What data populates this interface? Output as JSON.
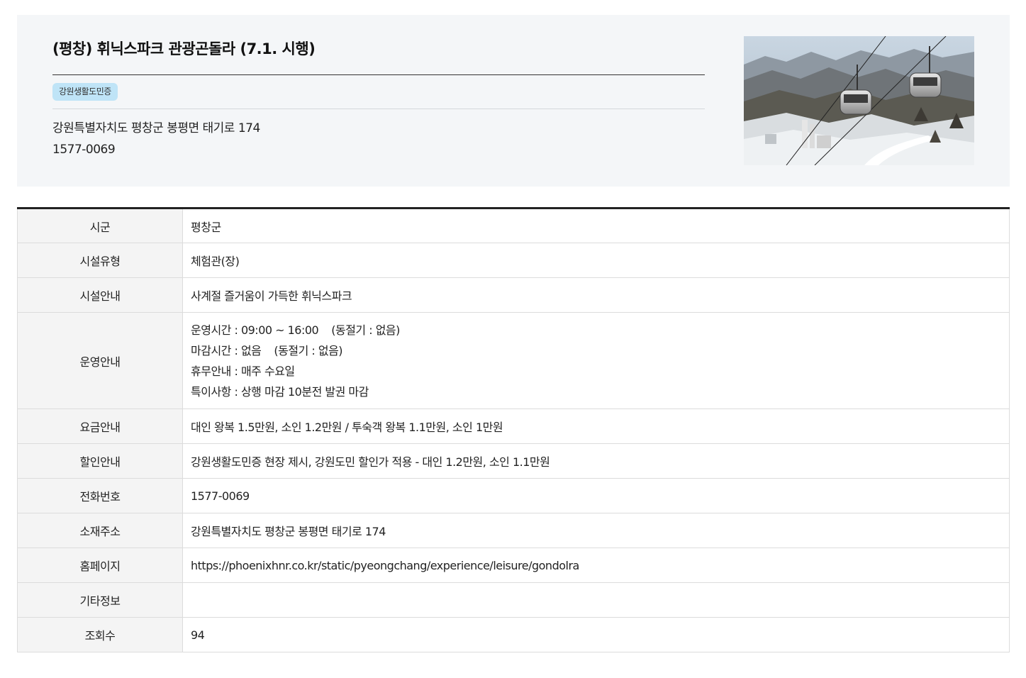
{
  "facility": {
    "title": "(평창) 휘닉스파크 관광곤돌라 (7.1. 시행)",
    "badge": "강원생활도민증",
    "address": "강원특별자치도 평창군 봉평면 태기로 174",
    "phone": "1577-0069"
  },
  "details": {
    "rows": [
      {
        "label": "시군",
        "value": "평창군"
      },
      {
        "label": "시설유형",
        "value": "체험관(장)"
      },
      {
        "label": "시설안내",
        "value": "사계절 즐거움이 가득한 휘닉스파크"
      },
      {
        "label": "운영안내"
      },
      {
        "label": "요금안내",
        "value": "대인 왕복 1.5만원, 소인 1.2만원 / 투숙객 왕복 1.1만원, 소인 1만원"
      },
      {
        "label": "할인안내",
        "value": "강원생활도민증 현장 제시, 강원도민 할인가 적용 - 대인 1.2만원, 소인 1.1만원"
      },
      {
        "label": "전화번호",
        "value": "1577-0069"
      },
      {
        "label": "소재주소",
        "value": "강원특별자치도 평창군 봉평면 태기로 174"
      },
      {
        "label": "홈페이지",
        "value": "https://phoenixhnr.co.kr/static/pyeongchang/experience/leisure/gondolra"
      },
      {
        "label": "기타정보",
        "value": ""
      },
      {
        "label": "조회수",
        "value": "94"
      }
    ],
    "operation": {
      "hours": "운영시간 : 09:00 ~ 16:00",
      "hours_winter": "(동절기 : 없음)",
      "closing": "마감시간 : 없음",
      "closing_winter": "(동절기 : 없음)",
      "holiday": "휴무안내 : 매주 수요일",
      "notes": "특이사항 : 상행 마감 10분전 발권 마감"
    }
  }
}
